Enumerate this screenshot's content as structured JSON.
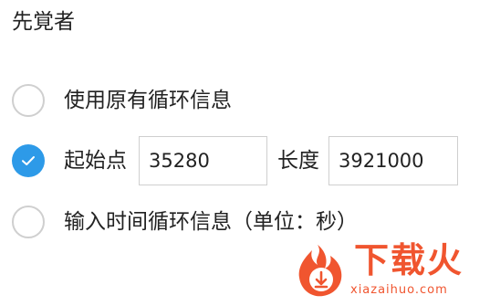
{
  "title": "先覚者",
  "options": [
    {
      "label": "使用原有循环信息",
      "selected": false
    },
    {
      "label": "起始点",
      "selected": true
    },
    {
      "label": "输入时间循环信息（单位：秒）",
      "selected": false
    }
  ],
  "fields": {
    "start_value": "35280",
    "length_label": "长度",
    "length_value": "3921000"
  },
  "watermark": {
    "brand": "下载火",
    "url": "xiazaihuo.com"
  },
  "colors": {
    "accent": "#2d9ae8",
    "radio_border": "#cfcfcf",
    "watermark": "#f0552f"
  },
  "icons": {
    "checked": "check-icon",
    "logo": "flame-download-icon"
  }
}
